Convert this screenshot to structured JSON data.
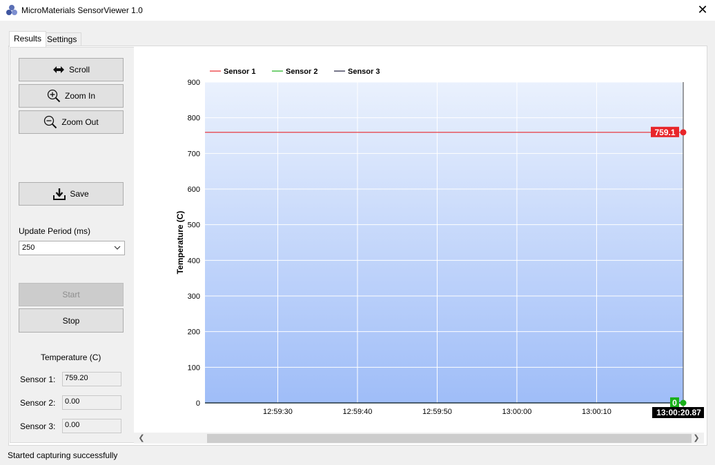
{
  "window": {
    "title": "MicroMaterials SensorViewer 1.0",
    "close_glyph": "✕"
  },
  "tabs": [
    {
      "label": "Results"
    },
    {
      "label": "Settings"
    }
  ],
  "controls": {
    "scroll_label": "Scroll",
    "zoom_in_label": "Zoom In",
    "zoom_out_label": "Zoom Out",
    "save_label": "Save",
    "update_period_label": "Update Period (ms)",
    "update_period_value": "250",
    "start_label": "Start",
    "stop_label": "Stop"
  },
  "readings": {
    "heading": "Temperature (C)",
    "sensors": [
      {
        "label": "Sensor 1:",
        "value": "759.20"
      },
      {
        "label": "Sensor 2:",
        "value": "0.00"
      },
      {
        "label": "Sensor 3:",
        "value": "0.00"
      }
    ]
  },
  "status": {
    "text": "Started capturing successfully"
  },
  "chart_data": {
    "type": "line",
    "ylabel": "Temperature (C)",
    "ylim": [
      0,
      900
    ],
    "yticks": [
      0,
      100,
      200,
      300,
      400,
      500,
      600,
      700,
      800,
      900
    ],
    "xticks": [
      "12:59:30",
      "12:59:40",
      "12:59:50",
      "13:00:00",
      "13:00:10"
    ],
    "x_range": [
      "12:59:20.87",
      "13:00:20.87"
    ],
    "cursor_time": "13:00:20.87",
    "legend_position": "top-left",
    "grid": true,
    "series": [
      {
        "name": "Sensor 1",
        "color": "#e8262a",
        "x": [
          "12:59:20.87",
          "13:00:20.87"
        ],
        "values": [
          759.1,
          759.1
        ],
        "last_label": "759.1"
      },
      {
        "name": "Sensor 2",
        "color": "#1ab01a",
        "x": [
          "12:59:20.87",
          "13:00:20.87"
        ],
        "values": [
          0,
          0
        ],
        "last_label": "0"
      },
      {
        "name": "Sensor 3",
        "color": "#1a1a3a",
        "x": [
          "12:59:20.87",
          "13:00:20.87"
        ],
        "values": [
          0,
          0
        ]
      }
    ]
  }
}
